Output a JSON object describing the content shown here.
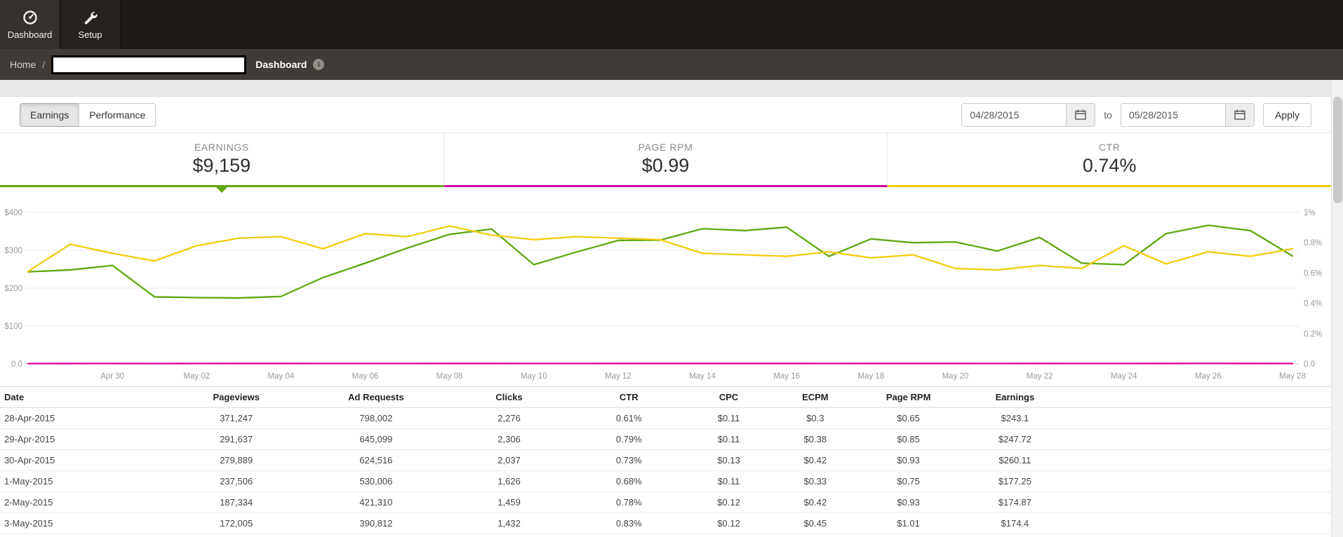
{
  "navbar": {
    "items": [
      {
        "label": "Dashboard",
        "icon": "dashboard-icon",
        "active": true
      },
      {
        "label": "Setup",
        "icon": "wrench-icon",
        "active": false
      }
    ]
  },
  "breadcrumb": {
    "home": "Home",
    "separator": "/",
    "current": "Dashboard"
  },
  "toolbar": {
    "tabs": [
      {
        "label": "Earnings",
        "active": true
      },
      {
        "label": "Performance",
        "active": false
      }
    ],
    "date_from": "04/28/2015",
    "to_label": "to",
    "date_to": "05/28/2015",
    "apply_label": "Apply"
  },
  "summary_cards": [
    {
      "label": "EARNINGS",
      "value": "$9,159",
      "color": "#5fa80f",
      "selected": true
    },
    {
      "label": "PAGE RPM",
      "value": "$0.99",
      "color": "#d4009d",
      "selected": false
    },
    {
      "label": "CTR",
      "value": "0.74%",
      "color": "#f2cc0d",
      "selected": false
    }
  ],
  "chart_data": {
    "type": "line",
    "x": [
      "Apr 28",
      "Apr 29",
      "Apr 30",
      "May 01",
      "May 02",
      "May 03",
      "May 04",
      "May 05",
      "May 06",
      "May 07",
      "May 08",
      "May 09",
      "May 10",
      "May 11",
      "May 12",
      "May 13",
      "May 14",
      "May 15",
      "May 16",
      "May 17",
      "May 18",
      "May 19",
      "May 20",
      "May 21",
      "May 22",
      "May 23",
      "May 24",
      "May 25",
      "May 26",
      "May 27",
      "May 28"
    ],
    "x_tick_labels": [
      "Apr 30",
      "May 02",
      "May 04",
      "May 06",
      "May 08",
      "May 10",
      "May 12",
      "May 14",
      "May 16",
      "May 18",
      "May 20",
      "May 22",
      "May 24",
      "May 26",
      "May 28"
    ],
    "x_tick_indices": [
      2,
      4,
      6,
      8,
      10,
      12,
      14,
      16,
      18,
      20,
      22,
      24,
      26,
      28,
      30
    ],
    "left_axis": {
      "max": 400,
      "ticks": [
        {
          "label": "$400",
          "value": 400
        },
        {
          "label": "$300",
          "value": 300
        },
        {
          "label": "$200",
          "value": 200
        },
        {
          "label": "$100",
          "value": 100
        },
        {
          "label": "0.0",
          "value": 0
        }
      ]
    },
    "right_axis": {
      "max": 1,
      "ticks": [
        {
          "label": "1%",
          "value": 1
        },
        {
          "label": "0.8%",
          "value": 0.8
        },
        {
          "label": "0.6%",
          "value": 0.6
        },
        {
          "label": "0.4%",
          "value": 0.4
        },
        {
          "label": "0.2%",
          "value": 0.2
        },
        {
          "label": "0.0",
          "value": 0
        }
      ]
    },
    "series": [
      {
        "name": "Earnings",
        "axis": "left",
        "color": "#5fa80f",
        "values": [
          243,
          248,
          260,
          177,
          175,
          174,
          178,
          228,
          266,
          306,
          342,
          356,
          262,
          295,
          326,
          327,
          357,
          352,
          361,
          284,
          330,
          320,
          322,
          298,
          334,
          266,
          262,
          344,
          366,
          352,
          285
        ]
      },
      {
        "name": "CTR",
        "axis": "right",
        "color": "#f2cc0d",
        "values": [
          0.61,
          0.79,
          0.73,
          0.68,
          0.78,
          0.83,
          0.84,
          0.76,
          0.86,
          0.84,
          0.91,
          0.85,
          0.82,
          0.84,
          0.83,
          0.82,
          0.73,
          0.72,
          0.71,
          0.74,
          0.7,
          0.72,
          0.63,
          0.62,
          0.65,
          0.63,
          0.78,
          0.66,
          0.74,
          0.71,
          0.76
        ]
      },
      {
        "name": "Page RPM",
        "axis": "left",
        "color": "#e10098",
        "values": [
          0.65,
          0.85,
          0.93,
          0.75,
          0.93,
          1.01,
          1.0,
          0.95,
          0.9,
          0.95,
          1.0,
          1.05,
          0.9,
          0.95,
          1.0,
          1.0,
          1.05,
          1.0,
          1.05,
          0.95,
          1.0,
          1.0,
          1.0,
          0.95,
          1.05,
          0.9,
          0.9,
          1.05,
          1.1,
          1.05,
          0.95
        ]
      }
    ],
    "grid": true,
    "legend": false
  },
  "table": {
    "columns": [
      "Date",
      "Pageviews",
      "Ad Requests",
      "Clicks",
      "CTR",
      "CPC",
      "ECPM",
      "Page RPM",
      "Earnings"
    ],
    "rows": [
      [
        "28-Apr-2015",
        "371,247",
        "798,002",
        "2,276",
        "0.61%",
        "$0.11",
        "$0.3",
        "$0.65",
        "$243.1"
      ],
      [
        "29-Apr-2015",
        "291,637",
        "645,099",
        "2,306",
        "0.79%",
        "$0.11",
        "$0.38",
        "$0.85",
        "$247.72"
      ],
      [
        "30-Apr-2015",
        "279,889",
        "624,516",
        "2,037",
        "0.73%",
        "$0.13",
        "$0.42",
        "$0.93",
        "$260.11"
      ],
      [
        "1-May-2015",
        "237,506",
        "530,006",
        "1,626",
        "0.68%",
        "$0.11",
        "$0.33",
        "$0.75",
        "$177.25"
      ],
      [
        "2-May-2015",
        "187,334",
        "421,310",
        "1,459",
        "0.78%",
        "$0.12",
        "$0.42",
        "$0.93",
        "$174.87"
      ],
      [
        "3-May-2015",
        "172,005",
        "390,812",
        "1,432",
        "0.83%",
        "$0.12",
        "$0.45",
        "$1.01",
        "$174.4"
      ]
    ]
  }
}
